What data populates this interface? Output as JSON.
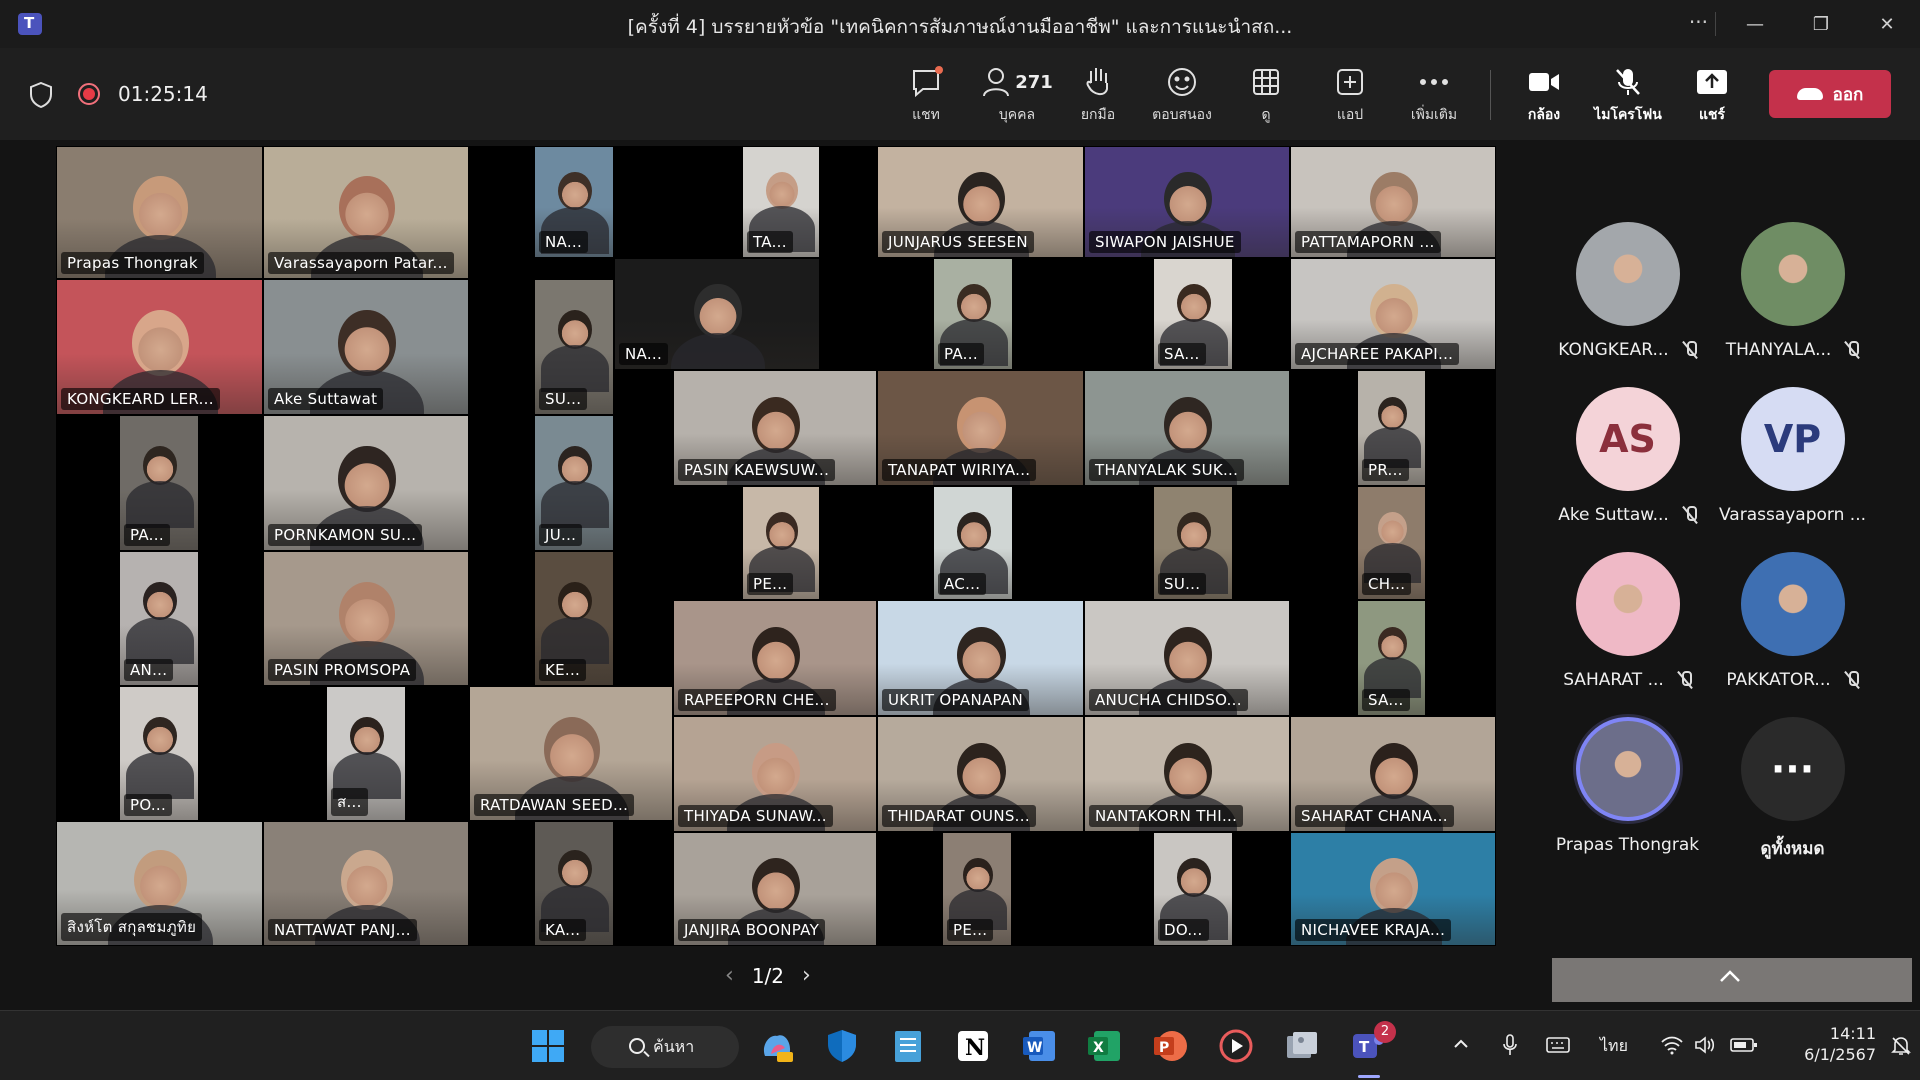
{
  "window": {
    "title": "[ครั้งที่ 4] บรรยายหัวข้อ \"เทคนิคการสัมภาษณ์งานมืออาชีพ\" และการแนะนำสถ...",
    "more": "···"
  },
  "meeting": {
    "timer": "01:25:14",
    "participant_count": "271",
    "toolbar": {
      "chat": "แชท",
      "people": "บุคคล",
      "raise_hand": "ยกมือ",
      "react": "ตอบสนอง",
      "view": "ดู",
      "apps": "แอป",
      "more": "เพิ่มเติม",
      "camera": "กล้อง",
      "mic": "ไมโครโฟน",
      "share": "แชร์",
      "leave": "ออก"
    }
  },
  "grid": {
    "tiles": [
      {
        "name": "Prapas Thongrak",
        "bg": "#8a7d6f",
        "head": "#c79a7a"
      },
      {
        "name": "Varassayaporn Patar...",
        "bg": "#b9ad98",
        "head": "#a8705a"
      },
      {
        "name": "NA...",
        "bg": "#6d8aa0",
        "head": "#3e3028"
      },
      {
        "name": "TA...",
        "bg": "#d5d3cf",
        "head": "#c59d86"
      },
      {
        "name": "JUNJARUS SEESEN",
        "bg": "#c3b2a0",
        "head": "#2a2420"
      },
      {
        "name": "SIWAPON JAISHUE",
        "bg": "#4b3b7c",
        "head": "#2a2a2a"
      },
      {
        "name": "PATTAMAPORN ...",
        "bg": "#c8c3bd",
        "head": "#9c7c66"
      },
      {
        "name": "KONGKEARD LER...",
        "bg": "#c4545a",
        "head": "#d8a68a"
      },
      {
        "name": "Ake Suttawat",
        "bg": "#898f91",
        "head": "#3d2e26"
      },
      {
        "name": "SU...",
        "bg": "#7b776f",
        "head": "#2a221c"
      },
      {
        "name": "NA...",
        "bg": "#1b1b1b",
        "head": "#2d2d2d"
      },
      {
        "name": "PA...",
        "bg": "#a9b0a2",
        "head": "#3a2c22"
      },
      {
        "name": "SA...",
        "bg": "#d9d5cf",
        "head": "#3a2a20"
      },
      {
        "name": "AJCHAREE PAKAPI...",
        "bg": "#c7c5c2",
        "head": "#d1b18f"
      },
      {
        "name": "PA...",
        "bg": "#6f6b66",
        "head": "#2e2620"
      },
      {
        "name": "PORNKAMON SU...",
        "bg": "#b7b3ad",
        "head": "#2e2521"
      },
      {
        "name": "JU...",
        "bg": "#7a8a92",
        "head": "#2b2420"
      },
      {
        "name": "PASIN KAEWSUW...",
        "bg": "#b6b1ab",
        "head": "#3a2a20"
      },
      {
        "name": "TANAPAT WIRIYA...",
        "bg": "#6c5646",
        "head": "#c79372"
      },
      {
        "name": "THANYALAK SUK...",
        "bg": "#8d9591",
        "head": "#2f2722"
      },
      {
        "name": "PR...",
        "bg": "#b7b2aa",
        "head": "#2b231e"
      },
      {
        "name": "PE...",
        "bg": "#c7b8a8",
        "head": "#3a2a22"
      },
      {
        "name": "AC...",
        "bg": "#d0d6d4",
        "head": "#2b241f"
      },
      {
        "name": "SU...",
        "bg": "#8f8370",
        "head": "#33281f"
      },
      {
        "name": "CH...",
        "bg": "#8e7c6b",
        "head": "#c4a08a"
      },
      {
        "name": "AN...",
        "bg": "#b6b2b0",
        "head": "#2a2220"
      },
      {
        "name": "PASIN PROMSOPA",
        "bg": "#a6998c",
        "head": "#b0826a"
      },
      {
        "name": "KE...",
        "bg": "#5a4d40",
        "head": "#2a2018"
      },
      {
        "name": "RAPEEPORN CHE...",
        "bg": "#a9958a",
        "head": "#2e231d"
      },
      {
        "name": "UKRIT OPANAPAN",
        "bg": "#c8d8e6",
        "head": "#2e2520"
      },
      {
        "name": "ANUCHA CHIDSO...",
        "bg": "#cac7c3",
        "head": "#2e241e"
      },
      {
        "name": "SA...",
        "bg": "#8e9880",
        "head": "#3a2a22"
      },
      {
        "name": "PO...",
        "bg": "#cfcbc7",
        "head": "#2f2621"
      },
      {
        "name": "ส...",
        "bg": "#cbc9c7",
        "head": "#2b221d"
      },
      {
        "name": "RATDAWAN SEED...",
        "bg": "#b4a696",
        "head": "#8a6a58"
      },
      {
        "name": "THIYADA SUNAW...",
        "bg": "#b5a393",
        "head": "#c79b85"
      },
      {
        "name": "THIDARAT OUNS...",
        "bg": "#b6aa9c",
        "head": "#2c231d"
      },
      {
        "name": "NANTAKORN THI...",
        "bg": "#c2b7aa",
        "head": "#2d241d"
      },
      {
        "name": "SAHARAT CHANA...",
        "bg": "#b2a597",
        "head": "#2b211c"
      },
      {
        "name": "สิงห์โต สกุลชมภูทิย",
        "bg": "#b6b6b2",
        "head": "#c29c7e"
      },
      {
        "name": "NATTAWAT PANJ...",
        "bg": "#8a8178",
        "head": "#caa88e"
      },
      {
        "name": "KA...",
        "bg": "#5e5a55",
        "head": "#2a231d"
      },
      {
        "name": "JANJIRA BOONPAY",
        "bg": "#a9a29a",
        "head": "#2e241e"
      },
      {
        "name": "PE...",
        "bg": "#8c7f74",
        "head": "#2a211c"
      },
      {
        "name": "DO...",
        "bg": "#c9c6c2",
        "head": "#2b231e"
      },
      {
        "name": "NICHAVEE KRAJA...",
        "bg": "#2d7fa6",
        "head": "#c4a089"
      }
    ]
  },
  "pager": {
    "prev": "‹",
    "label": "1/2",
    "next": "›"
  },
  "roster": [
    {
      "name": "KONGKEAR...",
      "initials": "",
      "bg": "#a3a7ab"
    },
    {
      "name": "THANYALA...",
      "initials": "",
      "bg": "#6f8d64"
    },
    {
      "name": "Ake Suttaw...",
      "initials": "AS",
      "bg": "#f4d3d8",
      "fg": "#8b2f3c"
    },
    {
      "name": "Varassayaporn ...",
      "initials": "VP",
      "bg": "#d6dcf3",
      "fg": "#2b3b7c"
    },
    {
      "name": "SAHARAT ...",
      "initials": "",
      "bg": "#efb9c6"
    },
    {
      "name": "PAKKATOR...",
      "initials": "",
      "bg": "#3e6fb2"
    },
    {
      "name": "Prapas Thongrak",
      "initials": "",
      "bg": "#6c6e8a"
    },
    {
      "name": "ดูทั้งหมด",
      "initials": "···",
      "bg": "#2a2a2a",
      "fg": "#ffffff"
    }
  ],
  "taskbar": {
    "search": "ค้นหา",
    "badge": "2",
    "lang": "ไทย",
    "time": "14:11",
    "date": "6/1/2567"
  }
}
